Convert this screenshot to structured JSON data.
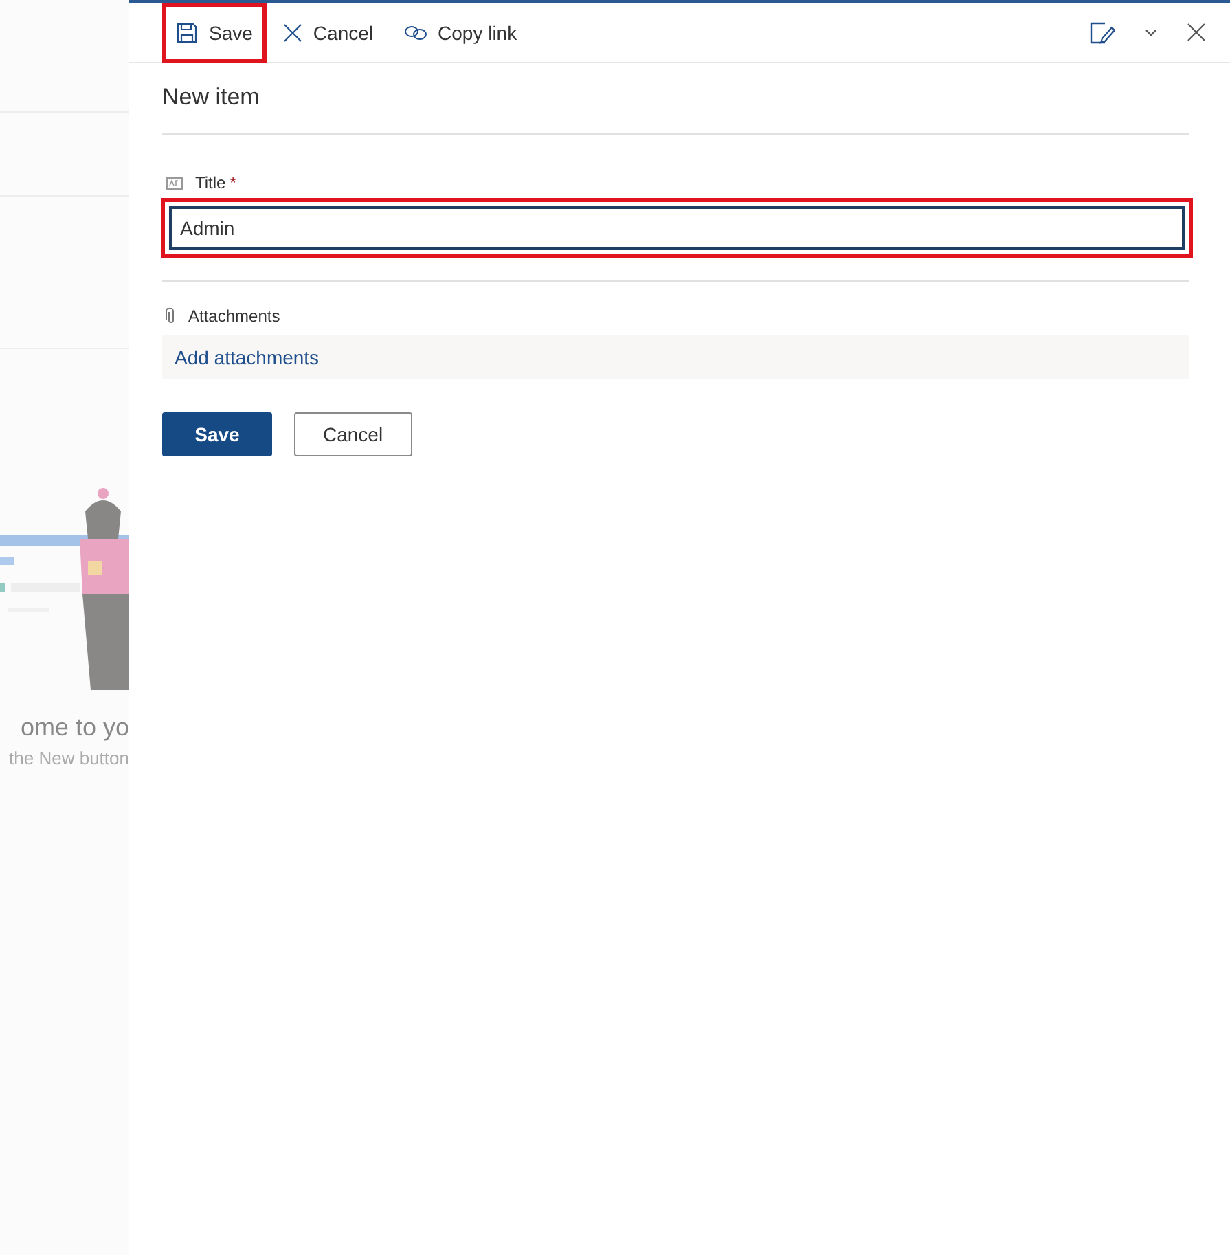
{
  "background": {
    "welcome_text": "ome to yo",
    "hint_text": "the New button"
  },
  "toolbar": {
    "actions": [
      {
        "kind": "save",
        "label": "Save",
        "highlighted": true
      },
      {
        "kind": "cancel",
        "label": "Cancel",
        "highlighted": false
      },
      {
        "kind": "link",
        "label": "Copy link",
        "highlighted": false
      }
    ]
  },
  "form": {
    "title": "New item",
    "fields": [
      {
        "label": "Title",
        "required_mark": "*",
        "value": "Admin",
        "highlighted": true
      }
    ],
    "attachments": {
      "label": "Attachments",
      "link": "Add attachments"
    },
    "buttons": [
      {
        "label": "Save",
        "primary": true
      },
      {
        "label": "Cancel",
        "primary": false
      }
    ]
  }
}
